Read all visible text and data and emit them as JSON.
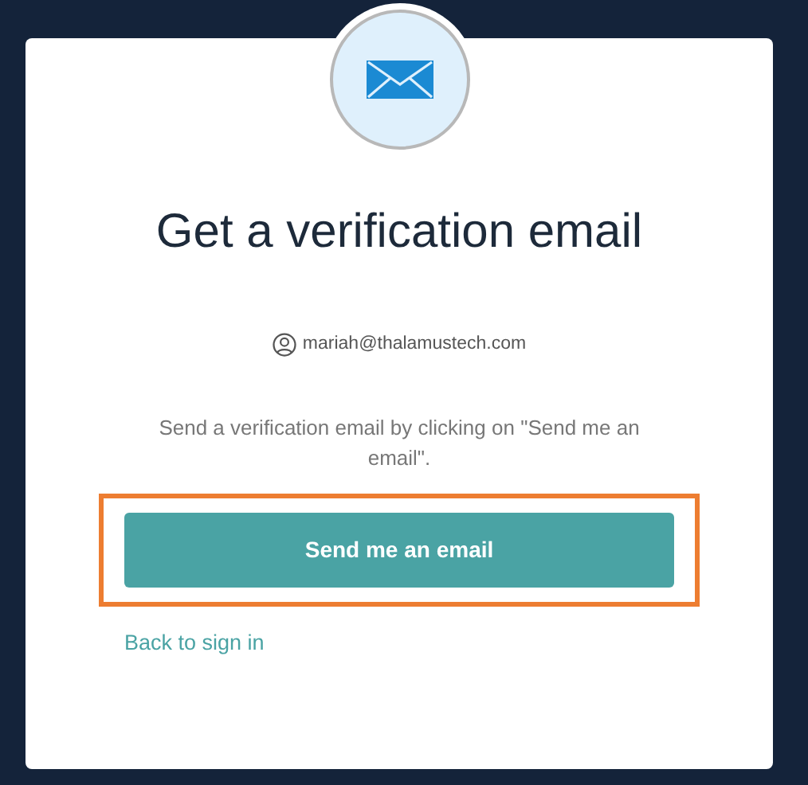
{
  "title": "Get a verification email",
  "account": {
    "email": "mariah@thalamustech.com"
  },
  "instructions": "Send a verification email by clicking on \"Send me an email\".",
  "primary_button": {
    "label": "Send me an email",
    "highlighted": true
  },
  "link": {
    "label": "Back to sign in"
  }
}
